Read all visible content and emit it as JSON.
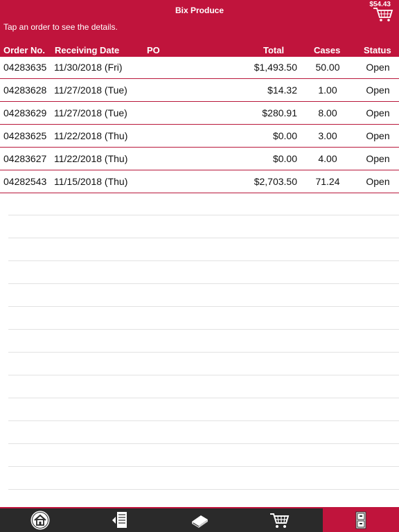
{
  "header": {
    "title": "Bix Produce",
    "hint": "Tap an order to see the details.",
    "cart_total": "$54.43"
  },
  "columns": {
    "order_no": "Order No.",
    "receiving_date": "Receiving Date",
    "po": "PO",
    "total": "Total",
    "cases": "Cases",
    "status": "Status"
  },
  "orders": [
    {
      "order_no": "04283635",
      "date": "11/30/2018 (Fri)",
      "po": "",
      "total": "$1,493.50",
      "cases": "50.00",
      "status": "Open"
    },
    {
      "order_no": "04283628",
      "date": "11/27/2018 (Tue)",
      "po": "",
      "total": "$14.32",
      "cases": "1.00",
      "status": "Open"
    },
    {
      "order_no": "04283629",
      "date": "11/27/2018 (Tue)",
      "po": "",
      "total": "$280.91",
      "cases": "8.00",
      "status": "Open"
    },
    {
      "order_no": "04283625",
      "date": "11/22/2018 (Thu)",
      "po": "",
      "total": "$0.00",
      "cases": "3.00",
      "status": "Open"
    },
    {
      "order_no": "04283627",
      "date": "11/22/2018 (Thu)",
      "po": "",
      "total": "$0.00",
      "cases": "4.00",
      "status": "Open"
    },
    {
      "order_no": "04282543",
      "date": "11/15/2018 (Thu)",
      "po": "",
      "total": "$2,703.50",
      "cases": "71.24",
      "status": "Open"
    }
  ],
  "tabbar": {
    "tabs": [
      {
        "name": "home",
        "icon": "home-icon",
        "active": false
      },
      {
        "name": "order-guide",
        "icon": "clipboard-icon",
        "active": false
      },
      {
        "name": "catalog",
        "icon": "book-icon",
        "active": false
      },
      {
        "name": "cart",
        "icon": "cart-icon",
        "active": false
      },
      {
        "name": "orders",
        "icon": "file-cabinet-icon",
        "active": true
      }
    ]
  },
  "colors": {
    "brand": "#c0143c",
    "tabbar_bg": "#2a2a2a"
  }
}
